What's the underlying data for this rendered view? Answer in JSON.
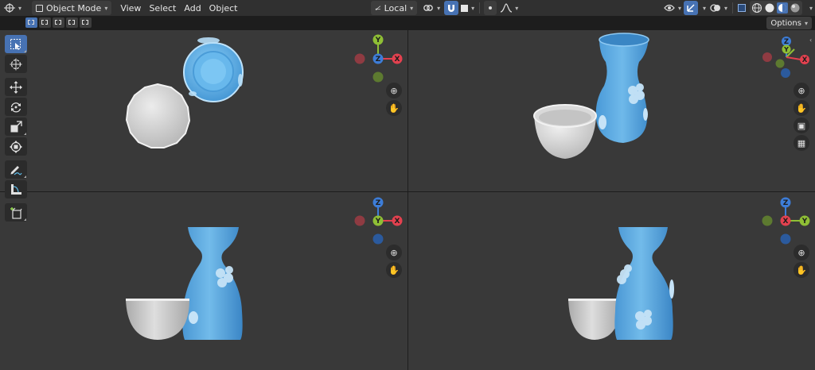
{
  "header": {
    "mode_label": "Object Mode",
    "menus": [
      "View",
      "Select",
      "Add",
      "Object"
    ],
    "pivot_label": "Local",
    "options_label": "Options"
  },
  "gizmo_labels": {
    "x": "X",
    "y": "Y",
    "z": "Z"
  },
  "colors": {
    "x_axis": "#e3414f",
    "y_axis": "#8fbf35",
    "z_axis": "#3d7dd8",
    "viewport_bg": "#393939",
    "accent": "#4772b3",
    "object_blue": "#5aaee6",
    "object_white": "#d6d6d6"
  },
  "icons": {
    "editor_type": "view3d-icon",
    "transform_pivot": "transform-orientation-icon",
    "snap": "magnet-icon",
    "proportional": "proportional-falloff-icon",
    "overlay": "overlay-icon",
    "shading": "shading-icon"
  }
}
